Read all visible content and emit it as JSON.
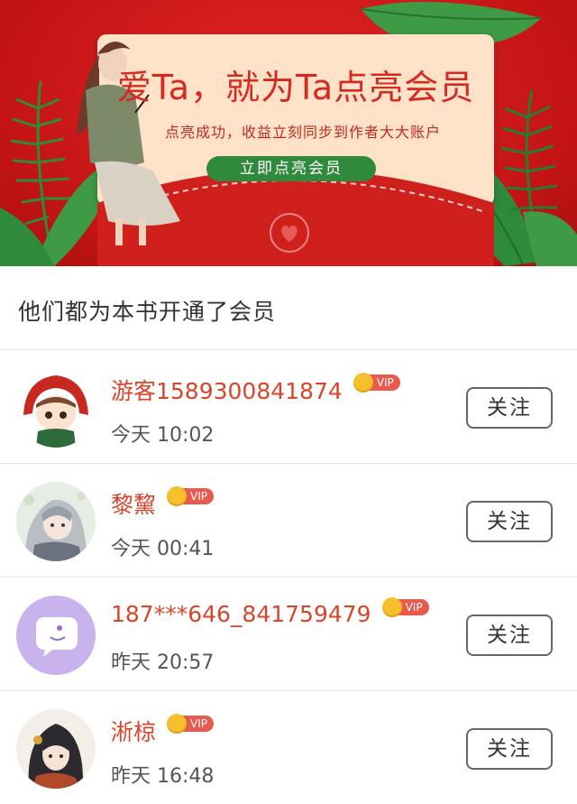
{
  "banner": {
    "title": "爱Ta，就为Ta点亮会员",
    "subtitle": "点亮成功，收益立刻同步到作者大大账户",
    "cta_label": "立即点亮会员",
    "colors": {
      "background": "#d91f1f",
      "card": "#fde2c8",
      "button": "#2f8a3c"
    }
  },
  "section": {
    "heading": "他们都为本书开通了会员"
  },
  "vip_badge_label": "VIP",
  "members": [
    {
      "name": "游客1589300841874",
      "time": "今天 10:02",
      "follow_label": "关注",
      "avatar": "red-hood-avatar"
    },
    {
      "name": "黎黧",
      "time": "今天 00:41",
      "follow_label": "关注",
      "avatar": "anime-girl-avatar"
    },
    {
      "name": "187***646_841759479",
      "time": "昨天 20:57",
      "follow_label": "关注",
      "avatar": "chat-bubble-avatar"
    },
    {
      "name": "淅椋",
      "time": "昨天 16:48",
      "follow_label": "关注",
      "avatar": "illustrated-girl-avatar"
    }
  ]
}
